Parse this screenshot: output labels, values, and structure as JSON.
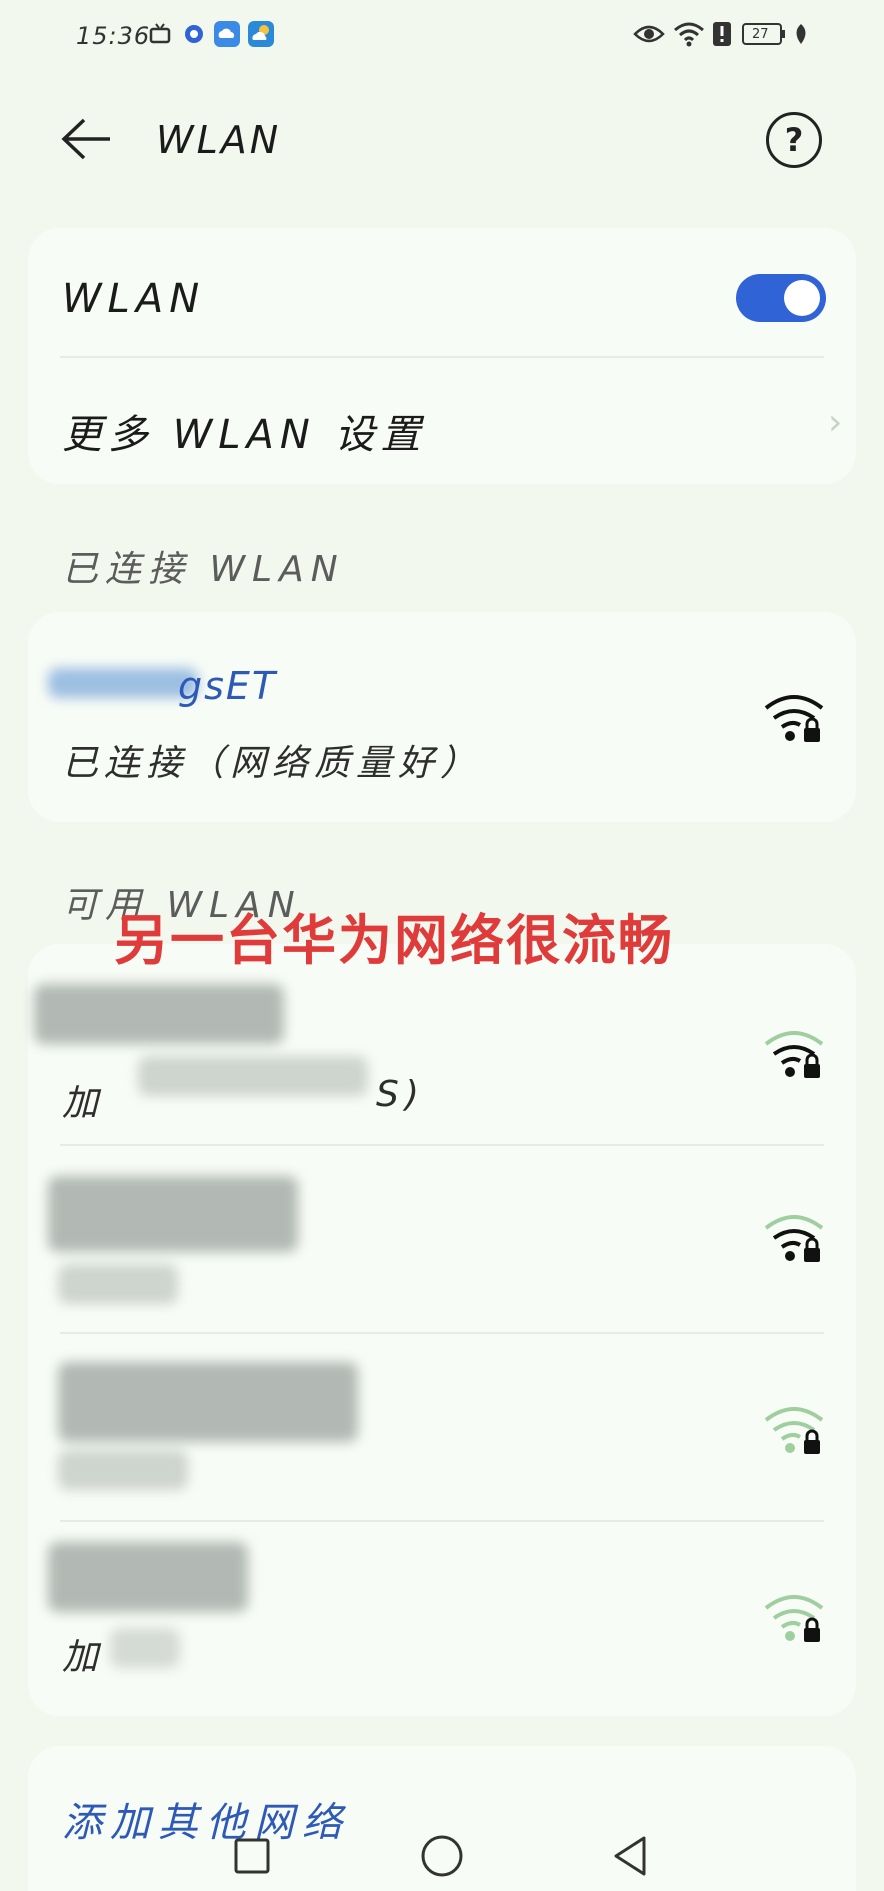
{
  "status_bar": {
    "time": "15:36",
    "battery": "27",
    "icons": [
      "tv-icon",
      "circle-app-icon",
      "cloud-app-icon",
      "weather-app-icon",
      "eye-icon",
      "wifi-status-icon",
      "alert-icon",
      "battery-icon",
      "leaf-icon"
    ]
  },
  "header": {
    "title": "WLAN",
    "help_label": "?"
  },
  "settings_card": {
    "wlan_label": "WLAN",
    "more_settings_label": "更多 WLAN 设置",
    "toggle_on": true
  },
  "connected_section": {
    "label": "已连接 WLAN",
    "network": {
      "name_visible": "gsET",
      "status": "已连接（网络质量好）"
    }
  },
  "available_section": {
    "label": "可用 WLAN",
    "networks": [
      {
        "status_fragment_a": "加",
        "status_fragment_b": "S)"
      },
      {
        "status_fragment_a": "",
        "status_fragment_b": ""
      },
      {
        "status_fragment_a": "",
        "status_fragment_b": ""
      },
      {
        "status_fragment_a": "加",
        "status_fragment_b": ""
      }
    ]
  },
  "overlay_caption": "另一台华为网络很流畅",
  "add_network_label": "添加其他网络",
  "colors": {
    "accent": "#2f63d6",
    "link": "#2e59b7",
    "caption": "#e03b3b",
    "background": "#f2f8ee"
  }
}
